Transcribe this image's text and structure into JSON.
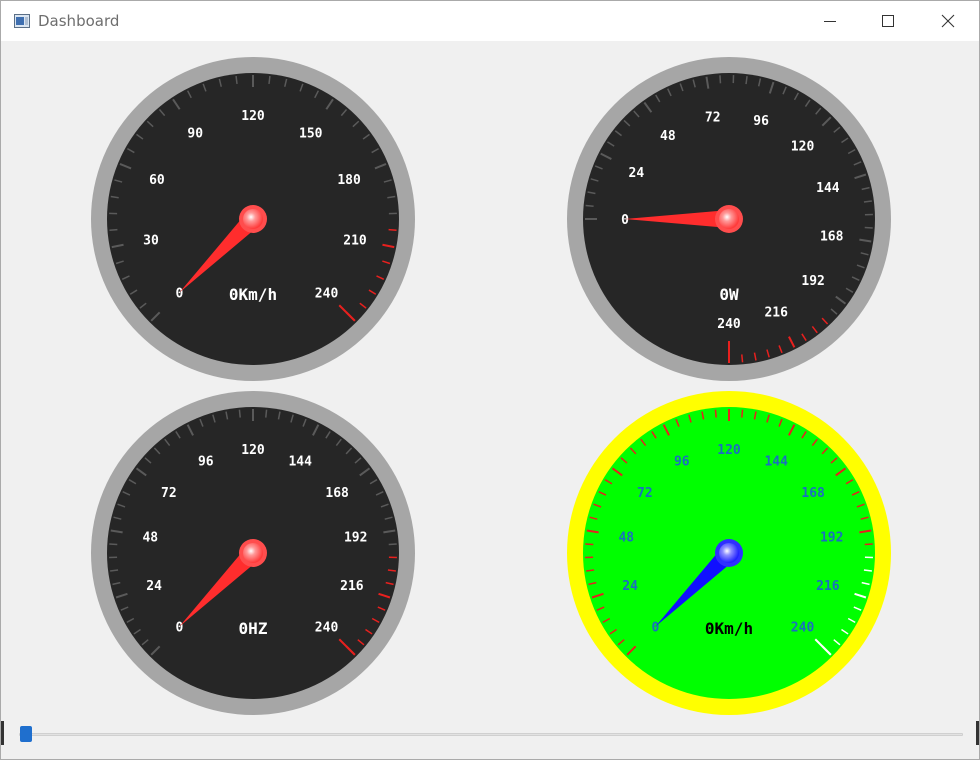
{
  "window": {
    "title": "Dashboard",
    "controls": {
      "minimize": "minimize-icon",
      "maximize": "maximize-icon",
      "close": "close-icon"
    }
  },
  "gauges": [
    {
      "theme": "dark",
      "value_text": "0Km/h",
      "value": 0,
      "min": 0,
      "max": 240,
      "labels": [
        "0",
        "30",
        "60",
        "90",
        "120",
        "150",
        "180",
        "210",
        "240"
      ],
      "start_deg": 225,
      "sweep": 270,
      "minor_ticks": 40,
      "red_from": 200,
      "ring_color": "#a6a6a6",
      "face_color": "#262626",
      "tick_color": "#5a5a5a",
      "red_tick_color": "#e8201e",
      "label_color": "#ffffff",
      "value_color": "#ffffff",
      "needle_color": "#ff2d2d",
      "hub_color": "#ff4d4d"
    },
    {
      "theme": "dark",
      "value_text": "0W",
      "value": 0,
      "min": 0,
      "max": 240,
      "labels": [
        "0",
        "24",
        "48",
        "72",
        "96",
        "120",
        "144",
        "168",
        "192",
        "216",
        "240"
      ],
      "start_deg": 180,
      "sweep": 270,
      "minor_ticks": 50,
      "red_from": 200,
      "ring_color": "#a6a6a6",
      "face_color": "#262626",
      "tick_color": "#5a5a5a",
      "red_tick_color": "#e8201e",
      "label_color": "#ffffff",
      "value_color": "#ffffff",
      "needle_color": "#ff2d2d",
      "hub_color": "#ff4d4d"
    },
    {
      "theme": "dark",
      "value_text": "0HZ",
      "value": 0,
      "min": 0,
      "max": 240,
      "labels": [
        "0",
        "24",
        "48",
        "72",
        "96",
        "120",
        "144",
        "168",
        "192",
        "216",
        "240"
      ],
      "start_deg": 225,
      "sweep": 270,
      "minor_ticks": 50,
      "red_from": 200,
      "ring_color": "#a6a6a6",
      "face_color": "#262626",
      "tick_color": "#5a5a5a",
      "red_tick_color": "#e8201e",
      "label_color": "#ffffff",
      "value_color": "#ffffff",
      "needle_color": "#ff2d2d",
      "hub_color": "#ff4d4d"
    },
    {
      "theme": "bright",
      "value_text": "0Km/h",
      "value": 0,
      "min": 0,
      "max": 240,
      "labels": [
        "0",
        "24",
        "48",
        "72",
        "96",
        "120",
        "144",
        "168",
        "192",
        "216",
        "240"
      ],
      "start_deg": 225,
      "sweep": 270,
      "minor_ticks": 50,
      "red_from": 200,
      "ring_color": "#ffff00",
      "face_color": "#00ff00",
      "tick_color": "#e8201e",
      "red_tick_color": "#ffffff",
      "label_color": "#1a6fc0",
      "value_color": "#000000",
      "needle_color": "#1010ff",
      "hub_color": "#2f2fff"
    }
  ],
  "slider": {
    "value": 0
  }
}
